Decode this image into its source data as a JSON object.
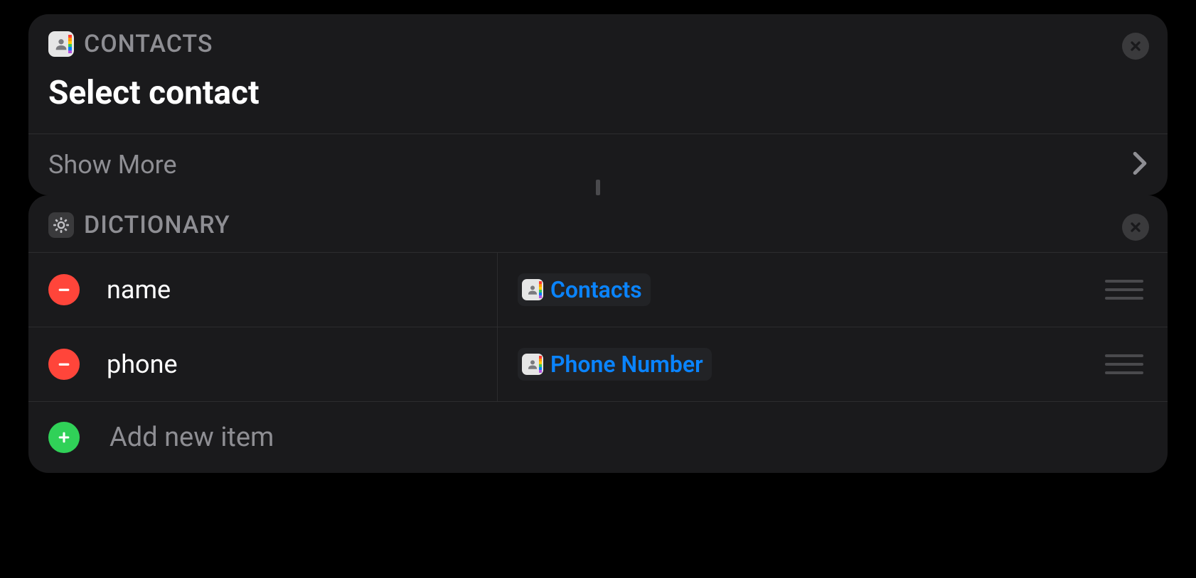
{
  "contacts_card": {
    "app_label": "CONTACTS",
    "title": "Select contact",
    "show_more": "Show More"
  },
  "dictionary_card": {
    "app_label": "DICTIONARY",
    "rows": [
      {
        "key": "name",
        "value_token": "Contacts"
      },
      {
        "key": "phone",
        "value_token": "Phone Number"
      }
    ],
    "add_label": "Add new item"
  }
}
